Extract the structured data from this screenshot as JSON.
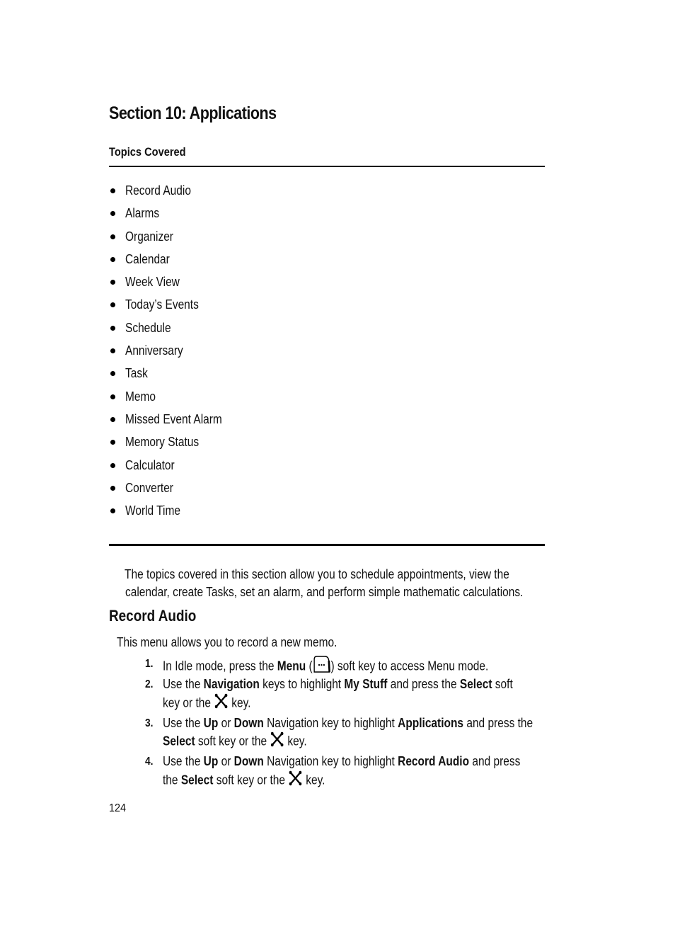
{
  "section_title": "Section 10: Applications",
  "topics_heading": "Topics Covered",
  "topics": [
    "Record Audio",
    "Alarms",
    "Organizer",
    "Calendar",
    "Week View",
    "Today’s Events",
    "Schedule",
    "Anniversary",
    "Task",
    "Memo",
    "Missed Event Alarm",
    "Memory Status",
    "Calculator",
    "Converter",
    "World Time"
  ],
  "intro": {
    "line1": "The topics covered in this section allow you to schedule appointments, view the",
    "line2": "calendar, create Tasks, set an alarm, and perform simple mathematic calculations."
  },
  "record_audio": {
    "heading": "Record Audio",
    "description": "This menu allows you to record a new memo.",
    "steps": [
      {
        "number": "1.",
        "t1": "In Idle mode, press the ",
        "b1": "Menu",
        "t2": " (",
        "icon": "menu-soft-key-icon",
        "t3": ") soft key to access Menu mode."
      },
      {
        "number": "2.",
        "t1": "Use the ",
        "b1": "Navigation",
        "t2": " keys to highlight ",
        "b2": "My Stuff",
        "t3": " and press the ",
        "b3": "Select",
        "t4": " soft",
        "t5": "key or the ",
        "icon": "select-key-icon",
        "t6": " key."
      },
      {
        "number": "3.",
        "t1": "Use the ",
        "b1": "Up",
        "t2": " or ",
        "b2": "Down",
        "t3": " Navigation key to highlight ",
        "b3": "Applications",
        "t4": " and press the",
        "b4": "Select",
        "t5": " soft key or the ",
        "icon": "select-key-icon",
        "t6": " key."
      },
      {
        "number": "4.",
        "t1": "Use the ",
        "b1": "Up",
        "t2": " or ",
        "b2": "Down",
        "t3": " Navigation key to highlight ",
        "b3": "Record Audio",
        "t4": " and press",
        "t5": "the ",
        "b4": "Select",
        "t6": " soft key or the ",
        "icon": "select-key-icon",
        "t7": " key."
      }
    ]
  },
  "page_number": "124"
}
